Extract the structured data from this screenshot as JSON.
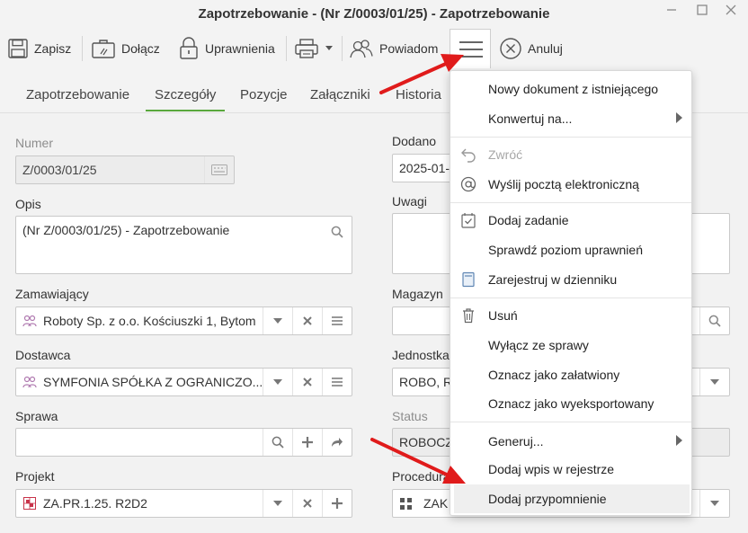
{
  "window": {
    "title": "Zapotrzebowanie - (Nr Z/0003/01/25) - Zapotrzebowanie"
  },
  "toolbar": {
    "save": "Zapisz",
    "attach": "Dołącz",
    "permissions": "Uprawnienia",
    "notify": "Powiadom",
    "cancel": "Anuluj"
  },
  "tabs": [
    "Zapotrzebowanie",
    "Szczegóły",
    "Pozycje",
    "Załączniki",
    "Historia"
  ],
  "active_tab": "Szczegóły",
  "form": {
    "number_label": "Numer",
    "number_value": "Z/0003/01/25",
    "added_label": "Dodano",
    "added_value": "2025-01-",
    "description_label": "Opis",
    "description_value": "(Nr Z/0003/01/25) - Zapotrzebowanie",
    "remarks_label": "Uwagi",
    "orderer_label": "Zamawiający",
    "orderer_value": "Roboty Sp. z o.o. Kościuszki 1, Bytom",
    "warehouse_label": "Magazyn",
    "supplier_label": "Dostawca",
    "supplier_value": "SYMFONIA SPÓŁKA Z OGRANICZO...",
    "unit_label": "Jednostka",
    "unit_value": "ROBO, Ro",
    "case_label": "Sprawa",
    "status_label": "Status",
    "status_value": "ROBOCZ",
    "project_label": "Projekt",
    "project_value": "ZA.PR.1.25. R2D2",
    "procedure_label": "Procedura",
    "procedure_value": "ZAK"
  },
  "menu": {
    "new_from_existing": "Nowy dokument z istniejącego",
    "convert": "Konwertuj na...",
    "return": "Zwróć",
    "send_email": "Wyślij pocztą elektroniczną",
    "add_task": "Dodaj zadanie",
    "check_permissions": "Sprawdź poziom uprawnień",
    "register_journal": "Zarejestruj w dzienniku",
    "delete": "Usuń",
    "exclude_case": "Wyłącz ze sprawy",
    "mark_done": "Oznacz jako załatwiony",
    "mark_exported": "Oznacz jako wyeksportowany",
    "generate": "Generuj...",
    "add_registry": "Dodaj wpis w rejestrze",
    "add_reminder": "Dodaj przypomnienie"
  },
  "colors": {
    "accent": "#5aa83d",
    "annotation_arrow": "#e01b1b"
  }
}
